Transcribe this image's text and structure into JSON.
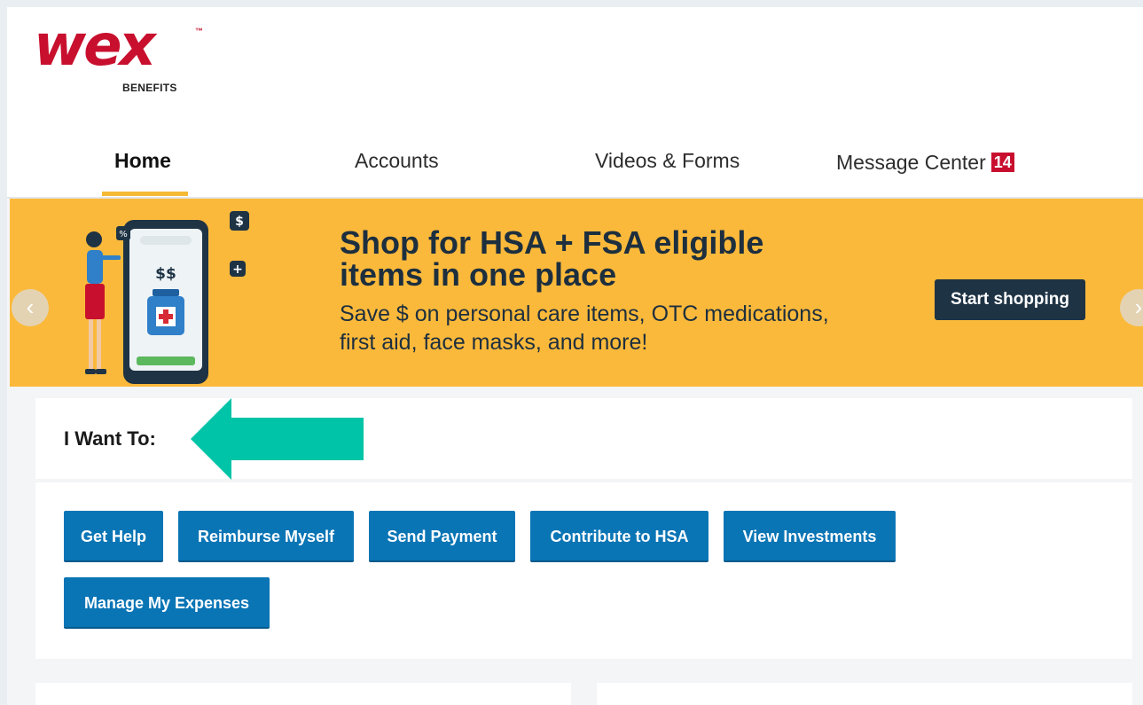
{
  "logo": {
    "brand": "wex",
    "trademark": "™",
    "subtitle": "BENEFITS"
  },
  "nav": {
    "items": [
      {
        "label": "Home",
        "active": true
      },
      {
        "label": "Accounts",
        "active": false
      },
      {
        "label": "Videos & Forms",
        "active": false
      },
      {
        "label": "Message Center",
        "active": false,
        "badge": "14"
      }
    ]
  },
  "banner": {
    "title_line1": "Shop for HSA + FSA eligible",
    "title_line2": "items in one place",
    "subtitle_line1": "Save $ on personal care items, OTC medications,",
    "subtitle_line2": "first aid, face masks, and more!",
    "cta_label": "Start shopping",
    "prev_icon": "chevron-left-icon",
    "next_icon": "chevron-right-icon",
    "phone_text": "$$",
    "bubble_percent": "%",
    "bubble_dollar": "$",
    "bubble_plus": "+"
  },
  "i_want_to": {
    "title": "I Want To:",
    "buttons": [
      "Get Help",
      "Reimburse Myself",
      "Send Payment",
      "Contribute to HSA",
      "View Investments",
      "Manage My Expenses"
    ]
  },
  "colors": {
    "brand_red": "#c8102e",
    "banner_yellow": "#fbb93b",
    "button_blue": "#0a75b5",
    "cta_dark": "#1e3344",
    "pointer_teal": "#00c4a7",
    "nav_underline": "#f5b935"
  }
}
